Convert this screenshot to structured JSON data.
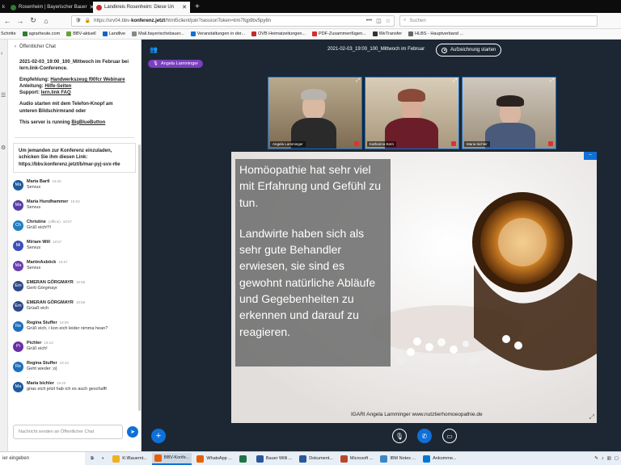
{
  "browser": {
    "tabs": [
      {
        "label": "Rosenheim | Bayerischer Bauer",
        "color": "#2e7d32"
      },
      {
        "label": "Landkreis Rosenheim: Diese Un",
        "color": "#c62828"
      }
    ],
    "tab_left_fragment": "k",
    "url_prefix": "https://srv04.bbv-",
    "url_domain": "konferenz.jetzt",
    "url_suffix": "/html5client/join?sessionToken=trm7fqp9bv5py6n",
    "search_placeholder": "Suchen"
  },
  "bookmarks": [
    {
      "label": "Schritte",
      "color": ""
    },
    {
      "label": "agrarheute.com",
      "color": "#2e7d32"
    },
    {
      "label": "BBV-aktuell",
      "color": "#6a9f3a"
    },
    {
      "label": "Landlive",
      "color": "#1565c0"
    },
    {
      "label": "Mail.bayerischebauer...",
      "color": "#888888"
    },
    {
      "label": "Veranstaltungen in der...",
      "color": "#0f70d7"
    },
    {
      "label": "OVB Heimatzeitungen...",
      "color": "#c62828"
    },
    {
      "label": "PDF-Zusammenfügen...",
      "color": "#d32f2f"
    },
    {
      "label": "WeTransfer",
      "color": "#333333"
    },
    {
      "label": "HLBS - Hauptverband ...",
      "color": "#666666"
    }
  ],
  "chat": {
    "header": "Öffentlicher Chat",
    "welcome": {
      "title": "2021-02-03_19:00_100_Mittwoch im Februar bei lern.link-Conference.",
      "recommend_prefix": "Empfehlung:",
      "recommend_link": "Handwerkszeug f00fcr Webinare",
      "guide_prefix": "Anleitung:",
      "guide_link": "Hilfe-Seiten",
      "support_prefix": "Support:",
      "support_link": "lern.link FAQ",
      "audio": "Audio starten mit dem Telefon-Knopf am unteren Bildschirmrand oder",
      "server_prefix": "This server is running",
      "server_link": "BigBlueButton"
    },
    "invite": "Um jemanden zur Konferenz einzuladen, schicken Sie ihm diesen Link: https://bbv.konferenz.jetzt/b/mar-pyj-svx-r6e",
    "messages": [
      {
        "initials": "Ma",
        "name": "Maria Bartl",
        "time": "18:46",
        "text": "Servus",
        "color": "#1e5b9f"
      },
      {
        "initials": "Ma",
        "name": "Maria Hundhammer",
        "time": "18:53",
        "text": "Servus",
        "color": "#5a3ea6"
      },
      {
        "initials": "Ch",
        "name": "Christine",
        "name_extra": "(offline)",
        "time": "18:57",
        "text": "Grüß eich!!!!",
        "color": "#1f7fbf"
      },
      {
        "initials": "Mi",
        "name": "Miriam Will",
        "time": "18:57",
        "text": "Servus",
        "color": "#3b4fb8"
      },
      {
        "initials": "Ma",
        "name": "MartinAsböck",
        "time": "18:57",
        "text": "Servus",
        "color": "#6a3fb0"
      },
      {
        "initials": "Em",
        "name": "EMERAN GÖRGMAYR",
        "time": "18:58",
        "text": "Gerti Görgmayr",
        "color": "#2d4a8a"
      },
      {
        "initials": "Em",
        "name": "EMERAN GÖRGMAYR",
        "time": "18:58",
        "text": "Grüaß eich",
        "color": "#2d4a8a"
      },
      {
        "initials": "Re",
        "name": "Regina Stuffer",
        "time": "19:08",
        "text": "Grüß eich, i kon eich leider nimma hean?",
        "color": "#1f6fbf"
      },
      {
        "initials": "Pi",
        "name": "Pichler",
        "time": "19:13",
        "text": "Grüß eich!",
        "color": "#6a2fa6"
      },
      {
        "initials": "Re",
        "name": "Regina Stuffer",
        "time": "19:13",
        "text": "Geht wieder ;o)",
        "color": "#1f6fbf"
      },
      {
        "initials": "Ma",
        "name": "Maria bichler",
        "time": "19:20",
        "text": "grias eich jetzt hab ich es auch geschafft",
        "color": "#1e5b9f"
      }
    ],
    "input_placeholder": "Nachricht senden an Öffentlicher Chat"
  },
  "meeting": {
    "title": "2021-02-03_19:00_100_Mittwoch im Februar",
    "record_label": "Aufzeichnung starten",
    "talker": "Angela Lamminger",
    "videos": [
      {
        "name": "Angela Lamminger"
      },
      {
        "name": "Katharina Kern"
      },
      {
        "name": "Maria bichler"
      }
    ]
  },
  "presentation": {
    "paragraph1": "Homöopathie hat sehr viel mit Erfahrung und Gefühl zu tun.",
    "paragraph2": "Landwirte haben sich als sehr gute Behandler erwiesen, sie sind es gewohnt natürliche Abläufe und Gegebenheiten zu erkennen und darauf zu reagieren.",
    "credit": "IGARI   Angela Lamminger   www.nutztierhomoeopathie.de"
  },
  "taskbar": {
    "search_placeholder": "ier eingeben",
    "items": [
      {
        "label": "K:\\Bauernt...",
        "color": "#f2b01e"
      },
      {
        "label": "BBV-Konfe...",
        "color": "#e66000"
      },
      {
        "label": "WhatsApp ...",
        "color": "#e66000"
      },
      {
        "label": "",
        "color": "#217346"
      },
      {
        "label": "Bauer Willi ...",
        "color": "#2b579a"
      },
      {
        "label": "Dokument...",
        "color": "#2b579a"
      },
      {
        "label": "Microsoft ...",
        "color": "#b7472a"
      },
      {
        "label": "IBM Notes ...",
        "color": "#3d86c6"
      },
      {
        "label": "Ankomme...",
        "color": "#0078d7"
      }
    ]
  }
}
